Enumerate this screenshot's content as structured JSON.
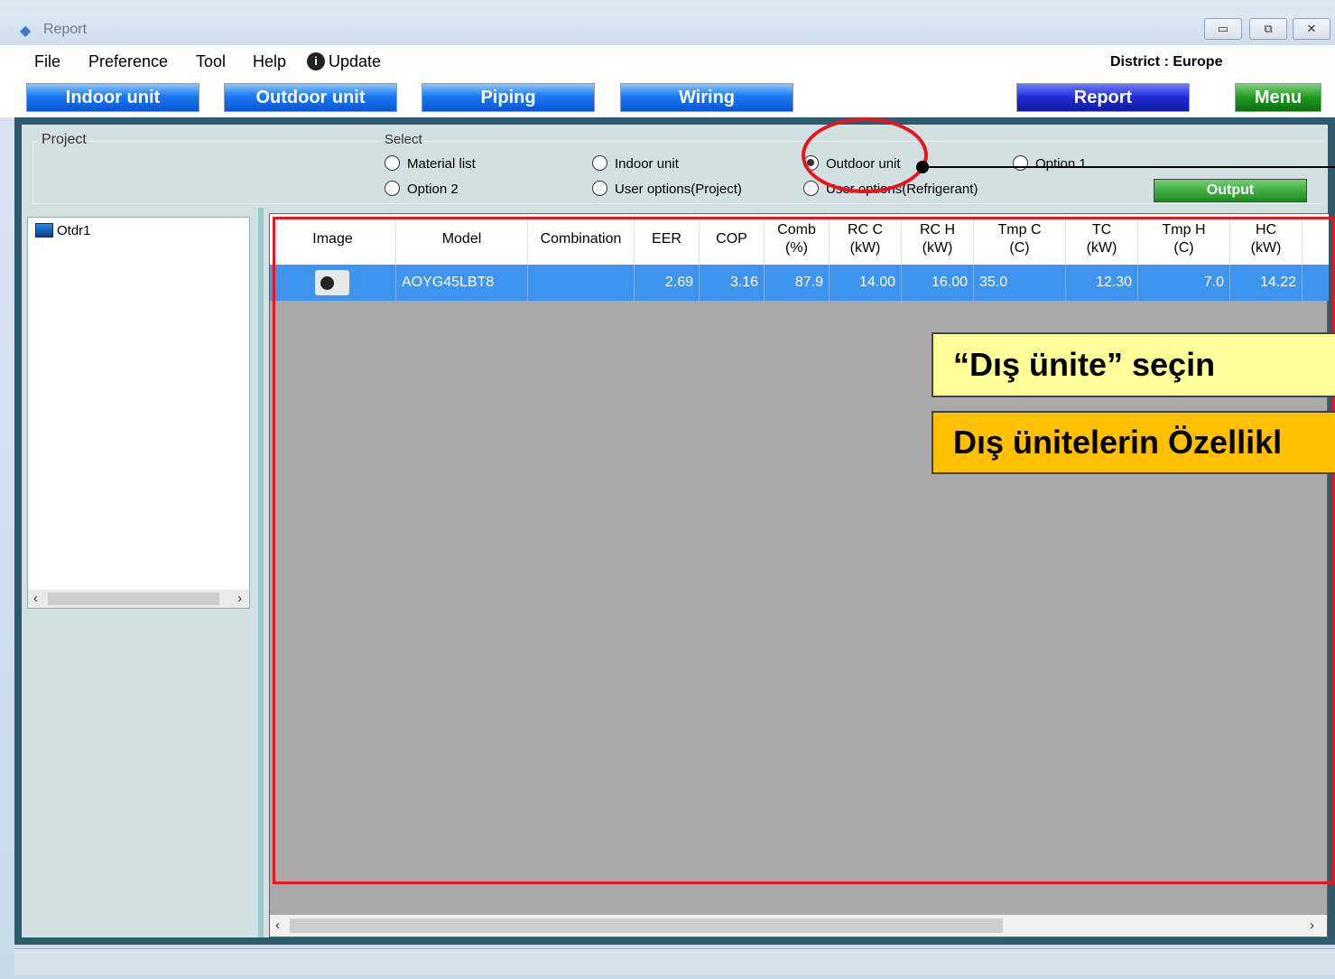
{
  "window": {
    "title": "Report",
    "buttons": [
      "▭",
      "⧉",
      "✕"
    ]
  },
  "menubar": {
    "items": [
      "File",
      "Preference",
      "Tool",
      "Help"
    ],
    "update_label": "Update",
    "district": "District : Europe"
  },
  "toolbar": {
    "indoor": "Indoor unit",
    "outdoor": "Outdoor unit",
    "piping": "Piping",
    "wiring": "Wiring",
    "report": "Report",
    "menu": "Menu"
  },
  "project": {
    "label": "Project",
    "tree_item": "Otdr1"
  },
  "select": {
    "label": "Select",
    "options": [
      "Material list",
      "Indoor unit",
      "Outdoor unit",
      "Option 1",
      "Option 2",
      "User options(Project)",
      "User options(Refrigerant)"
    ],
    "selected": "Outdoor unit",
    "output_label": "Output"
  },
  "table": {
    "columns": [
      "Image",
      "Model",
      "Combination",
      "EER",
      "COP",
      "Comb\n(%)",
      "RC C\n(kW)",
      "RC H\n(kW)",
      "Tmp C\n(C)",
      "TC\n(kW)",
      "Tmp H\n(C)",
      "HC\n(kW)"
    ],
    "rows": [
      {
        "model": "AOYG45LBT8",
        "combination": "",
        "eer": "2.69",
        "cop": "3.16",
        "comb": "87.9",
        "rcc": "14.00",
        "rch": "16.00",
        "tmpc": "35.0",
        "tc": "12.30",
        "tmph": "7.0",
        "hc": "14.22"
      }
    ]
  },
  "annotations": {
    "note1": "“Dış ünite” seçin",
    "note2": "Dış ünitelerin Özellikl"
  },
  "colors": {
    "nav_blue": "#1a79f0",
    "report_blue": "#1e2bd8",
    "menu_green": "#1f9a1f",
    "row_selected": "#3f95ee",
    "annotation_red": "#e8141e",
    "note_yellow": "#ffff99",
    "note_orange": "#ffc000"
  }
}
